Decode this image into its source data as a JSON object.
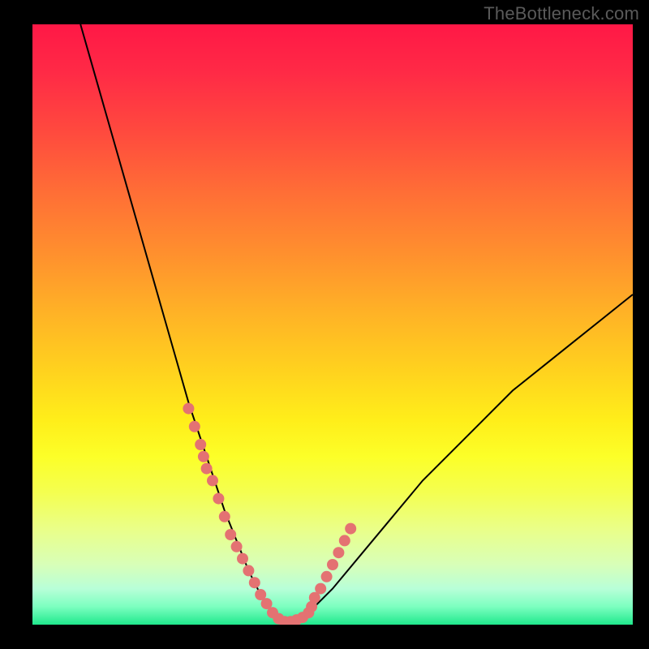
{
  "watermark": "TheBottleneck.com",
  "colors": {
    "background": "#000000",
    "curve": "#000000",
    "dots": "#e47272",
    "gradient_top": "#ff1846",
    "gradient_bottom": "#20e88c"
  },
  "chart_data": {
    "type": "line",
    "title": "",
    "xlabel": "",
    "ylabel": "",
    "xlim": [
      0,
      100
    ],
    "ylim": [
      0,
      100
    ],
    "grid": false,
    "watermark": "TheBottleneck.com",
    "series": [
      {
        "name": "curve",
        "style": "line",
        "x": [
          8,
          10,
          12,
          14,
          16,
          18,
          20,
          22,
          24,
          26,
          28,
          30,
          32,
          34,
          36,
          38,
          40,
          42,
          46,
          50,
          55,
          60,
          65,
          70,
          75,
          80,
          85,
          90,
          95,
          100
        ],
        "y": [
          100,
          93,
          86,
          79,
          72,
          65,
          58,
          51,
          44,
          37,
          31,
          25,
          19,
          14,
          9,
          5,
          2,
          0.5,
          2,
          6,
          12,
          18,
          24,
          29,
          34,
          39,
          43,
          47,
          51,
          55
        ]
      },
      {
        "name": "dots",
        "style": "scatter",
        "x": [
          26,
          27,
          28,
          28.5,
          29,
          30,
          31,
          32,
          33,
          34,
          35,
          36,
          37,
          38,
          39,
          40,
          41,
          42,
          43,
          44,
          45,
          46,
          46.5,
          47,
          48,
          49,
          50,
          51,
          52,
          53
        ],
        "y": [
          36,
          33,
          30,
          28,
          26,
          24,
          21,
          18,
          15,
          13,
          11,
          9,
          7,
          5,
          3.5,
          2,
          1,
          0.5,
          0.5,
          0.8,
          1.2,
          2,
          3,
          4.5,
          6,
          8,
          10,
          12,
          14,
          16
        ]
      }
    ]
  }
}
